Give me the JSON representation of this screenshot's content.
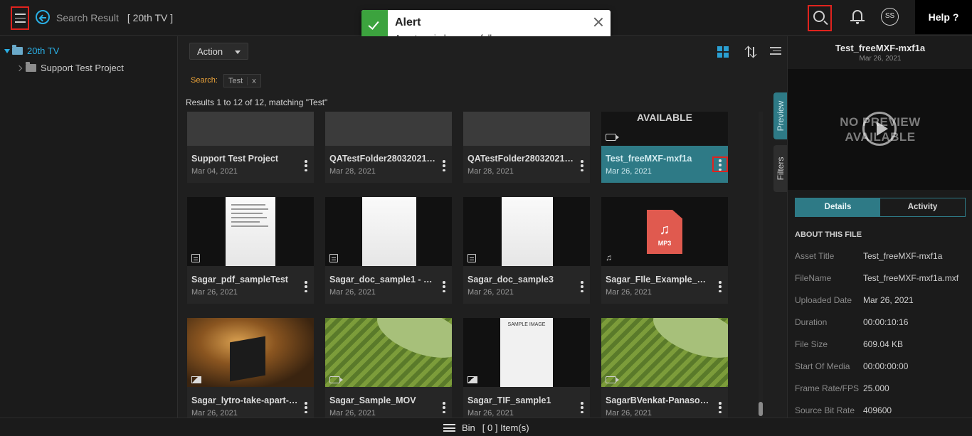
{
  "header": {
    "breadcrumb_label": "Search Result",
    "breadcrumb_context": "[ 20th TV ]",
    "avatar_initials": "SS",
    "help_label": "Help ?"
  },
  "alert": {
    "title": "Alert",
    "message": "Asset copied successfully"
  },
  "tree": {
    "root": "20th TV",
    "child": "Support Test Project"
  },
  "toolbar": {
    "action_label": "Action"
  },
  "search": {
    "label": "Search:",
    "term": "Test",
    "clear": "x",
    "results_text": "Results 1 to 12 of 12, matching \"Test\""
  },
  "cards": [
    {
      "name": "Support Test Project",
      "date": "Mar 04, 2021",
      "kind": "folder"
    },
    {
      "name": "QATestFolder28032021 ...",
      "date": "Mar 28, 2021",
      "kind": "folder"
    },
    {
      "name": "QATestFolder28032021 ...",
      "date": "Mar 28, 2021",
      "kind": "folder"
    },
    {
      "name": "Test_freeMXF-mxf1a",
      "date": "Mar 26, 2021",
      "kind": "video",
      "overlay": "AVAILABLE"
    },
    {
      "name": "Sagar_pdf_sampleTest",
      "date": "Mar 26, 2021",
      "kind": "document"
    },
    {
      "name": "Sagar_doc_sample1 - Co...",
      "date": "Mar 26, 2021",
      "kind": "document"
    },
    {
      "name": "Sagar_doc_sample3",
      "date": "Mar 26, 2021",
      "kind": "document"
    },
    {
      "name": "Sagar_FIle_Example_WA...",
      "date": "Mar 26, 2021",
      "kind": "audio",
      "badge": "MP3"
    },
    {
      "name": "Sagar_lytro-take-apart-i2...",
      "date": "Mar 26, 2021",
      "kind": "image"
    },
    {
      "name": "Sagar_Sample_MOV",
      "date": "Mar 26, 2021",
      "kind": "video"
    },
    {
      "name": "Sagar_TIF_sample1",
      "date": "Mar 26, 2021",
      "kind": "image",
      "overlay": "SAMPLE IMAGE"
    },
    {
      "name": "SagarBVenkat-Panasoni...",
      "date": "Mar 26, 2021",
      "kind": "video"
    }
  ],
  "side_tabs": {
    "preview": "Preview",
    "filters": "Filters"
  },
  "details": {
    "title": "Test_freeMXF-mxf1a",
    "date": "Mar 26, 2021",
    "no_preview_1": "NO PREVIEW",
    "no_preview_2": "AVAILABLE",
    "tab_details": "Details",
    "tab_activity": "Activity",
    "section": "ABOUT THIS FILE",
    "props": [
      {
        "k": "Asset Title",
        "v": "Test_freeMXF-mxf1a"
      },
      {
        "k": "FileName",
        "v": "Test_freeMXF-mxf1a.mxf"
      },
      {
        "k": "Uploaded Date",
        "v": "Mar 26, 2021"
      },
      {
        "k": "Duration",
        "v": "00:00:10:16"
      },
      {
        "k": "File Size",
        "v": "609.04 KB"
      },
      {
        "k": "Start Of Media",
        "v": "00:00:00:00"
      },
      {
        "k": "Frame Rate/FPS",
        "v": "25.000"
      },
      {
        "k": "Source Bit Rate",
        "v": "409600"
      }
    ]
  },
  "bottom": {
    "bin_label": "Bin",
    "bin_count": "[ 0 ] Item(s)"
  },
  "colors": {
    "accent": "#2e7a86",
    "link": "#2ab0e6",
    "highlight": "#e0231e",
    "success": "#3ca33e"
  }
}
